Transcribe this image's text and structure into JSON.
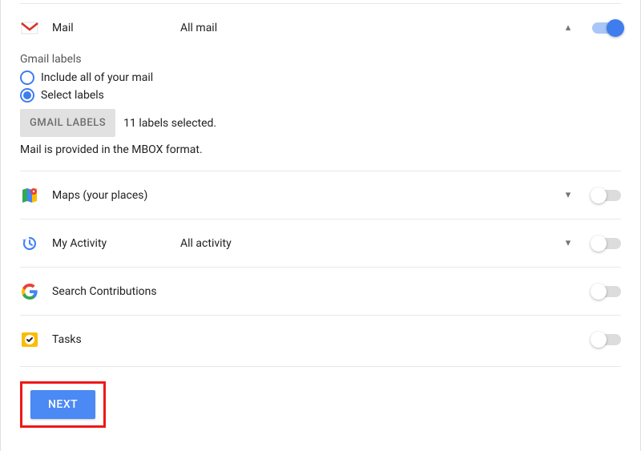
{
  "rows": {
    "mail": {
      "name": "Mail",
      "option": "All mail"
    },
    "maps": {
      "name": "Maps (your places)",
      "option": ""
    },
    "activity": {
      "name": "My Activity",
      "option": "All activity"
    },
    "search": {
      "name": "Search Contributions",
      "option": ""
    },
    "tasks": {
      "name": "Tasks",
      "option": ""
    }
  },
  "gmail": {
    "labels_heading": "Gmail labels",
    "include_all": "Include all of your mail",
    "select_labels": "Select labels",
    "labels_button": "GMAIL LABELS",
    "labels_selected": "11 labels selected.",
    "format_note": "Mail is provided in the MBOX format."
  },
  "footer": {
    "next": "NEXT"
  }
}
